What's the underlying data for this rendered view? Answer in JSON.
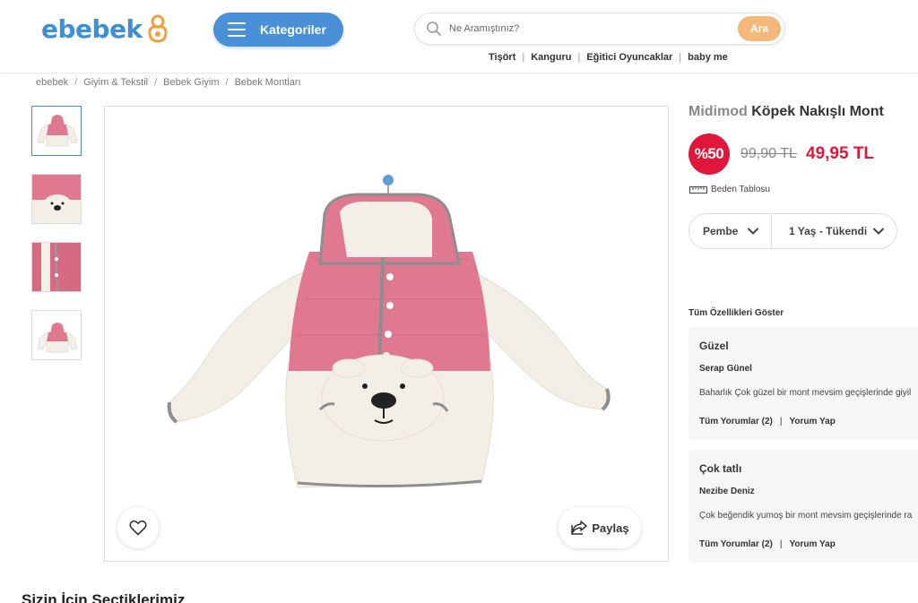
{
  "header": {
    "logo_text": "ebebek",
    "categories_label": "Kategoriler",
    "search_placeholder": "Ne Aramıştınız?",
    "search_button": "Ara",
    "quick_links": [
      "Tişört",
      "Kanguru",
      "Eğitici Oyuncaklar",
      "baby me"
    ]
  },
  "breadcrumb": [
    "ebebek",
    "Giyim & Tekstil",
    "Bebek Giyim",
    "Bebek Montları"
  ],
  "product": {
    "brand": "Midimod",
    "name": "Köpek Nakışlı Mont",
    "discount_badge": "%50",
    "old_price": "99,90 TL",
    "new_price": "49,95 TL",
    "size_chart_label": "Beden Tablosu",
    "color_selected": "Pembe",
    "size_selected": "1 Yaş - Tükendi",
    "share_label": "Paylaş"
  },
  "features_link": "Tüm Özellikleri Göster",
  "reviews": [
    {
      "title": "Güzel",
      "author": "Serap Günel",
      "text": "Baharlık Çok güzel bir mont mevsim geçişlerinde giyil",
      "all_reviews": "Tüm Yorumlar (2)",
      "write_review": "Yorum Yap"
    },
    {
      "title": "Çok tatlı",
      "author": "Nezibe Deniz",
      "text": "Çok beğendik yumoş bir mont mevsim geçişlerinde ra",
      "all_reviews": "Tüm Yorumlar (2)",
      "write_review": "Yorum Yap"
    }
  ],
  "section_title": "Sizin İçin Seçtiklerimiz",
  "colors": {
    "brand_blue": "#4a90d9",
    "search_orange": "#f3b87a",
    "discount_red": "#e0173a",
    "jacket_pink": "#e0788f",
    "fleece_cream": "#f4efe6"
  }
}
